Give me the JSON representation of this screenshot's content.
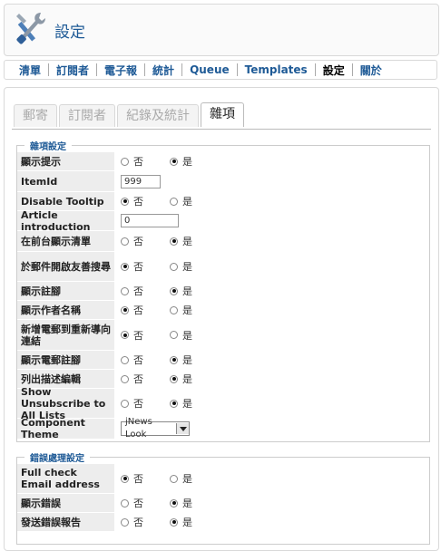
{
  "header": {
    "title": "設定"
  },
  "menu": [
    "清單",
    "訂閱者",
    "電子報",
    "統計",
    "Queue",
    "Templates",
    "設定",
    "關於"
  ],
  "tabs": [
    "郵寄",
    "訂閱者",
    "紀錄及統計",
    "雜項"
  ],
  "misc_section": {
    "legend": "雜項設定",
    "rows": [
      {
        "label": "顯示提示",
        "type": "radio",
        "no": "否",
        "yes": "是",
        "selected": "yes"
      },
      {
        "label": "ItemId",
        "type": "text",
        "value": "999"
      },
      {
        "label": "Disable Tooltip",
        "type": "radio",
        "no": "否",
        "yes": "是",
        "selected": "no"
      },
      {
        "label": "Article introduction",
        "type": "text",
        "value": "0"
      },
      {
        "label": "在前台顯示清單",
        "type": "radio",
        "no": "否",
        "yes": "是",
        "selected": "yes"
      },
      {
        "label": "於郵件開啟友善搜尋",
        "type": "radio",
        "no": "否",
        "yes": "是",
        "selected": "no"
      },
      {
        "label": "顯示註腳",
        "type": "radio",
        "no": "否",
        "yes": "是",
        "selected": "yes"
      },
      {
        "label": "顯示作者名稱",
        "type": "radio",
        "no": "否",
        "yes": "是",
        "selected": "no"
      },
      {
        "label": "新增電郵到重新導向連結",
        "type": "radio",
        "no": "否",
        "yes": "是",
        "selected": "no"
      },
      {
        "label": "顯示電郵註腳",
        "type": "radio",
        "no": "否",
        "yes": "是",
        "selected": "yes"
      },
      {
        "label": "列出描述編輯",
        "type": "radio",
        "no": "否",
        "yes": "是",
        "selected": "yes"
      },
      {
        "label": "Show Unsubscribe to All Lists",
        "type": "radio",
        "no": "否",
        "yes": "是",
        "selected": "yes"
      },
      {
        "label": "Component Theme",
        "type": "select",
        "value": "jNews Look"
      }
    ]
  },
  "error_section": {
    "legend": "錯誤處理設定",
    "rows": [
      {
        "label": "Full check Email address",
        "type": "radio",
        "no": "否",
        "yes": "是",
        "selected": "no"
      },
      {
        "label": "顯示錯誤",
        "type": "radio",
        "no": "否",
        "yes": "是",
        "selected": "yes"
      },
      {
        "label": "發送錯誤報告",
        "type": "radio",
        "no": "否",
        "yes": "是",
        "selected": "yes"
      }
    ]
  }
}
